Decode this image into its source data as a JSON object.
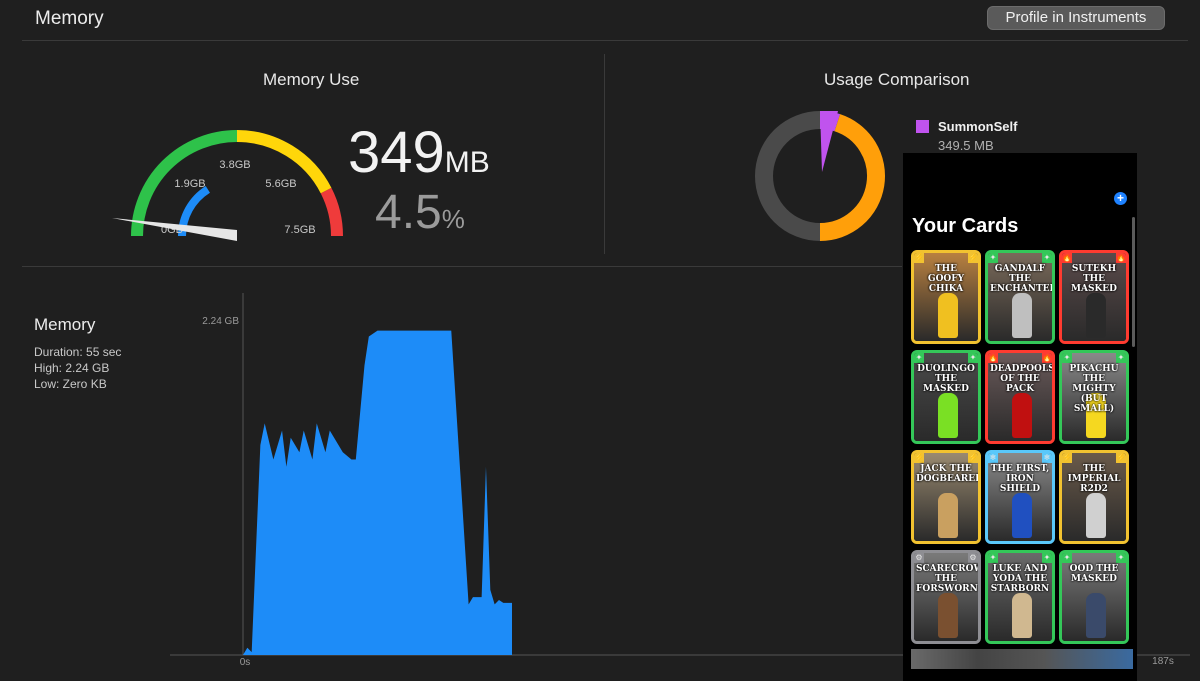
{
  "header": {
    "title": "Memory",
    "profile_button": "Profile in Instruments"
  },
  "memory_use": {
    "title": "Memory Use",
    "value": "349",
    "unit": "MB",
    "percent": "4.5",
    "percent_symbol": "%",
    "gauge": {
      "labels": [
        "0GB",
        "1.9GB",
        "3.8GB",
        "5.6GB",
        "7.5GB"
      ],
      "segment_colors": [
        "#2ec24a",
        "#ffd60a",
        "#ef3b3b"
      ],
      "needle_color": "#e6e6e6",
      "fill_color": "#1d8cf8",
      "level_fraction": 0.045
    }
  },
  "usage_comparison": {
    "title": "Usage Comparison",
    "legend": {
      "name": "SummonSelf",
      "value": "349.5 MB",
      "color": "#c053ee"
    },
    "donut_colors": {
      "app": "#c053ee",
      "free": "#ff9f0a",
      "other": "#4a4a4a"
    },
    "donut_fractions": {
      "app": 0.05,
      "free": 0.45,
      "other": 0.5
    }
  },
  "sidebar": {
    "title": "Memory",
    "duration": "Duration: 55 sec",
    "high": "High: 2.24 GB",
    "low": "Low: Zero KB"
  },
  "chart_data": {
    "type": "area",
    "title": "",
    "xlabel": "",
    "ylabel": "",
    "y_tick_label": "2.24 GB",
    "x_start_label": "0s",
    "x_end_label": "187s",
    "ylim": [
      0,
      2.5
    ],
    "xlim": [
      0,
      187
    ],
    "color": "#1d8cf8",
    "x": [
      0,
      1,
      2,
      4,
      5,
      7,
      9,
      10,
      11,
      13,
      14,
      16,
      17,
      19,
      20,
      22,
      23,
      25,
      26,
      28,
      29,
      31,
      33,
      34,
      35,
      36,
      38,
      40,
      48,
      52,
      53,
      54,
      55,
      56,
      57,
      58,
      59,
      60,
      61,
      62
    ],
    "values": [
      0,
      0.05,
      0.02,
      1.45,
      1.6,
      1.35,
      1.55,
      1.3,
      1.5,
      1.4,
      1.55,
      1.35,
      1.6,
      1.4,
      1.55,
      1.45,
      1.4,
      1.35,
      1.35,
      2.0,
      2.2,
      2.24,
      2.24,
      2.24,
      2.24,
      2.24,
      2.24,
      2.24,
      2.24,
      0.35,
      0.4,
      0.4,
      0.4,
      1.3,
      0.45,
      0.35,
      0.38,
      0.36,
      0.36,
      0.36
    ]
  },
  "phone": {
    "title": "Your Cards",
    "add_icon": "+",
    "cards": [
      {
        "title": "THE GOOFY CHIKA",
        "border": "#f2c230",
        "bg": "#b88040",
        "fig": "#f0c020",
        "badge_l": "⚡",
        "badge_r": "⚡"
      },
      {
        "title": "GANDALF THE ENCHANTER",
        "border": "#34c759",
        "bg": "#7a6a5a",
        "fig": "#bfbfbf",
        "badge_l": "✦",
        "badge_r": "✦"
      },
      {
        "title": "SUTEKH THE MASKED",
        "border": "#ff3b30",
        "bg": "#5a4a4a",
        "fig": "#2a2a2a",
        "badge_l": "🔥",
        "badge_r": "🔥"
      },
      {
        "title": "DUOLINGO THE MASKED",
        "border": "#34c759",
        "bg": "#4a4a4a",
        "fig": "#7ae024",
        "badge_l": "✦",
        "badge_r": "✦"
      },
      {
        "title": "DEADPOOLS OF THE PACK",
        "border": "#ff3b30",
        "bg": "#6a5a5a",
        "fig": "#c01010",
        "badge_l": "🔥",
        "badge_r": "🔥"
      },
      {
        "title": "PIKACHU THE MIGHTY (BUT SMALL)",
        "border": "#34c759",
        "bg": "#8a8a8a",
        "fig": "#f5d820",
        "badge_l": "✦",
        "badge_r": "✦"
      },
      {
        "title": "JACK THE DOGBEARER",
        "border": "#f2c230",
        "bg": "#9a8a70",
        "fig": "#c9a060",
        "badge_l": "⚡",
        "badge_r": "⚡"
      },
      {
        "title": "THE FIRST, IRON SHIELD",
        "border": "#5ac8fa",
        "bg": "#8a8a8a",
        "fig": "#2050c0",
        "badge_l": "❄",
        "badge_r": "❄"
      },
      {
        "title": "THE IMPERIAL R2D2",
        "border": "#f2c230",
        "bg": "#6a5a4a",
        "fig": "#d0d0d0",
        "badge_l": "⚡",
        "badge_r": "⚡"
      },
      {
        "title": "SCARECROW THE FORSWORN",
        "border": "#8e8e93",
        "bg": "#7a7a7a",
        "fig": "#7a5030",
        "badge_l": "⚙",
        "badge_r": "⚙"
      },
      {
        "title": "LUKE AND YODA THE STARBORN",
        "border": "#34c759",
        "bg": "#6a6a6a",
        "fig": "#d0b890",
        "badge_l": "✦",
        "badge_r": "✦"
      },
      {
        "title": "OOD THE MASKED",
        "border": "#34c759",
        "bg": "#7a7a7a",
        "fig": "#3a4a6a",
        "badge_l": "✦",
        "badge_r": "✦"
      }
    ]
  }
}
